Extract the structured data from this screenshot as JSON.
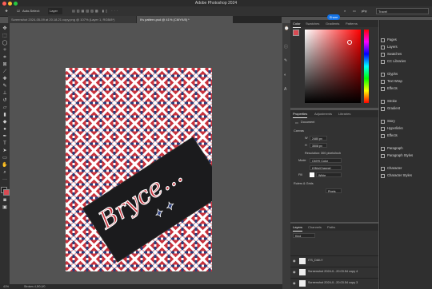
{
  "app": {
    "title": "Adobe Photoshop 2024"
  },
  "optbar": {
    "auto_select": "Auto-Select:",
    "layer_select": "Layer",
    "share": "Share",
    "top_right": "phy",
    "workspace_pill": "Travel"
  },
  "tabs": [
    {
      "label": "Screenshot 2024-05-09 at 20.18.21 copy.png @ 107% (Layer 1, RGB/8*)"
    },
    {
      "label": "It's pattern.psd @ 41% (CMYK/8) *"
    }
  ],
  "status": {
    "zoom": "41%",
    "doc_info": "Strokes 4,5/0,0/0"
  },
  "color_panel": {
    "tabs": [
      "Color",
      "Swatches",
      "Gradients",
      "Patterns"
    ]
  },
  "properties_panel": {
    "tabs": [
      "Properties",
      "Adjustments",
      "Libraries"
    ],
    "section_doc": "Document",
    "section_canvas": "Canvas",
    "w_label": "W",
    "w_value": "2480 px",
    "h_label": "H",
    "h_value": "3508 px",
    "resolution": "Resolution: 300 pixels/inch",
    "mode_label": "Mode",
    "mode_value": "CMYK Color",
    "bit_value": "8 Bits/Channel",
    "fill_label": "Fill",
    "fill_value": "White",
    "section_rulers": "Rulers & Grids",
    "units_value": "Pixels"
  },
  "layers_panel": {
    "tabs": [
      "Layers",
      "Channels",
      "Paths"
    ],
    "kind": "Kind",
    "layers": [
      {
        "name": "ITS_DAILY"
      },
      {
        "name": "Screenshot 2024-0...20.03.54 copy 4"
      },
      {
        "name": "Screenshot 2024-0...20.03.54 copy 3"
      }
    ]
  },
  "right_panel": {
    "groups": [
      [
        "Pages",
        "Layers",
        "Swatches",
        "CC Libraries"
      ],
      [
        "Glyphs",
        "Text Wrap",
        "Effects"
      ],
      [
        "Stroke",
        "Gradient"
      ],
      [
        "Story",
        "Hyperlinks",
        "Effects"
      ],
      [
        "Paragraph",
        "Paragraph Styles"
      ],
      [
        "Character",
        "Character Styles"
      ]
    ]
  },
  "artwork": {
    "text": "Bryce...",
    "colors": {
      "red": "#c8323c",
      "blue": "#2c3e7a",
      "white": "#ffffff",
      "dark": "#1a1a1a"
    }
  },
  "colors": {
    "accent": "#1473e6",
    "picked": "#d94a52"
  }
}
